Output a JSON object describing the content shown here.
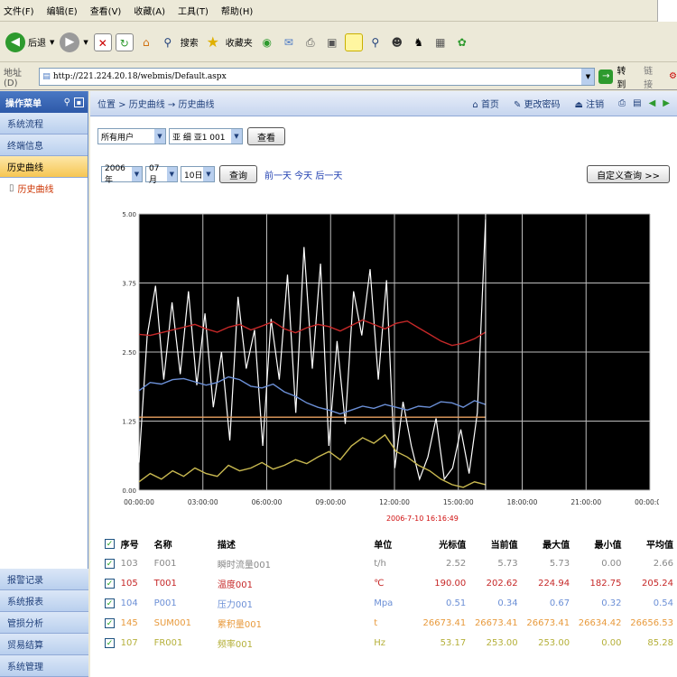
{
  "menu": [
    "文件(F)",
    "编辑(E)",
    "查看(V)",
    "收藏(A)",
    "工具(T)",
    "帮助(H)"
  ],
  "toolbar": {
    "back": "后退",
    "search": "搜索",
    "favorites": "收藏夹"
  },
  "address": {
    "label": "地址(D)",
    "url": "http://221.224.20.18/webmis/Default.aspx",
    "go": "转到",
    "links": "链接"
  },
  "sidebar": {
    "title": "操作菜单",
    "items": [
      "系统流程",
      "终端信息",
      "历史曲线"
    ],
    "sub": "历史曲线",
    "bottom": [
      "报警记录",
      "系统报表",
      "管损分析",
      "贸易结算",
      "系统管理"
    ]
  },
  "crumb": {
    "text": "位置 > 历史曲线 → 历史曲线",
    "home": "首页",
    "pwd": "更改密码",
    "logout": "注销"
  },
  "filter": {
    "user": "所有用户",
    "device": "亚 细 亚1  001",
    "view": "查看",
    "year": "2006年",
    "month": "07月",
    "day": "10日",
    "query": "查询",
    "nav": "前一天 今天 后一天",
    "custom": "自定义查询 >>"
  },
  "chart_data": {
    "type": "line",
    "ylim": [
      0,
      5
    ],
    "yticks": [
      "0.00",
      "1.25",
      "2.50",
      "3.75",
      "5.00"
    ],
    "xticks": [
      "00:00:00",
      "03:00:00",
      "06:00:00",
      "09:00:00",
      "12:00:00",
      "15:00:00",
      "18:00:00",
      "21:00:00",
      "00:00:00"
    ],
    "cursor_label": "2006-7-10 16:16:49",
    "series": [
      {
        "color": "#ffffff",
        "values": [
          0.5,
          2.8,
          3.7,
          2.0,
          3.4,
          2.1,
          3.6,
          1.9,
          3.2,
          1.5,
          2.5,
          0.9,
          3.5,
          2.2,
          2.9,
          0.8,
          3.1,
          2.0,
          3.9,
          1.4,
          4.4,
          2.2,
          4.1,
          0.8,
          2.7,
          1.2,
          3.6,
          2.8,
          4.0,
          2.0,
          3.8,
          0.4,
          1.6,
          0.8,
          0.2,
          0.6,
          1.3,
          0.2,
          0.4,
          1.1,
          0.3,
          1.4,
          4.9
        ]
      },
      {
        "color": "#c62828",
        "values": [
          2.82,
          2.8,
          2.85,
          2.9,
          2.95,
          3.0,
          2.92,
          2.86,
          2.95,
          3.0,
          2.9,
          2.97,
          3.05,
          2.92,
          2.85,
          2.94,
          3.0,
          2.96,
          2.88,
          2.98,
          3.08,
          3.0,
          2.92,
          3.02,
          3.06,
          2.94,
          2.82,
          2.7,
          2.62,
          2.66,
          2.74,
          2.86
        ]
      },
      {
        "color": "#6b8fd6",
        "values": [
          1.8,
          1.95,
          1.92,
          2.0,
          2.02,
          1.96,
          1.9,
          1.95,
          2.05,
          2.0,
          1.88,
          1.85,
          1.92,
          1.78,
          1.7,
          1.58,
          1.5,
          1.45,
          1.38,
          1.45,
          1.52,
          1.48,
          1.55,
          1.5,
          1.45,
          1.52,
          1.5,
          1.6,
          1.58,
          1.5,
          1.62,
          1.55
        ]
      },
      {
        "color": "#c8b850",
        "values": [
          0.15,
          0.3,
          0.2,
          0.35,
          0.25,
          0.4,
          0.3,
          0.25,
          0.45,
          0.35,
          0.4,
          0.5,
          0.38,
          0.45,
          0.55,
          0.48,
          0.6,
          0.7,
          0.55,
          0.8,
          0.95,
          0.85,
          1.0,
          0.7,
          0.6,
          0.45,
          0.35,
          0.2,
          0.1,
          0.05,
          0.15,
          0.1
        ]
      },
      {
        "color": "#e8a060",
        "values": [
          1.32,
          1.32,
          1.32,
          1.32,
          1.32,
          1.32,
          1.32,
          1.32,
          1.32,
          1.32,
          1.32
        ]
      }
    ]
  },
  "legend": {
    "headers": [
      "序号",
      "名称",
      "描述",
      "单位",
      "光标值",
      "当前值",
      "最大值",
      "最小值",
      "平均值"
    ],
    "rows": [
      {
        "no": "103",
        "name": "F001",
        "desc": "瞬时流量001",
        "unit": "t/h",
        "cursor": "2.52",
        "current": "5.73",
        "max": "5.73",
        "min": "0.00",
        "avg": "2.66",
        "color": "#ffffff"
      },
      {
        "no": "105",
        "name": "T001",
        "desc": "温度001",
        "unit": "℃",
        "cursor": "190.00",
        "current": "202.62",
        "max": "224.94",
        "min": "182.75",
        "avg": "205.24",
        "color": "#c62828"
      },
      {
        "no": "104",
        "name": "P001",
        "desc": "压力001",
        "unit": "Mpa",
        "cursor": "0.51",
        "current": "0.34",
        "max": "0.67",
        "min": "0.32",
        "avg": "0.54",
        "color": "#6b8fd6"
      },
      {
        "no": "145",
        "name": "SUM001",
        "desc": "累积量001",
        "unit": "t",
        "cursor": "26673.41",
        "current": "26673.41",
        "max": "26673.41",
        "min": "26634.42",
        "avg": "26656.53",
        "color": "#e89a3c"
      },
      {
        "no": "107",
        "name": "FR001",
        "desc": "频率001",
        "unit": "Hz",
        "cursor": "53.17",
        "current": "253.00",
        "max": "253.00",
        "min": "0.00",
        "avg": "85.28",
        "color": "#b5b03a"
      }
    ]
  }
}
